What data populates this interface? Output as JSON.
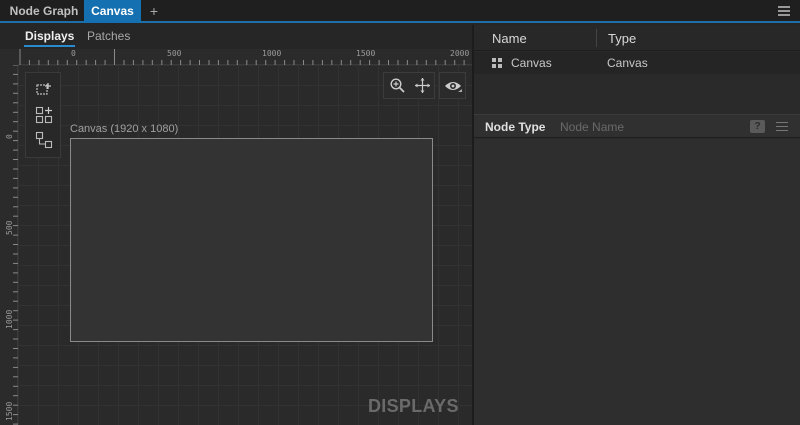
{
  "tabs": [
    {
      "label": "Node Graph",
      "active": false
    },
    {
      "label": "Canvas",
      "active": true
    }
  ],
  "add_tab_label": "+",
  "left_panel": {
    "subtabs": [
      {
        "label": "Displays",
        "active": true
      },
      {
        "label": "Patches",
        "active": false
      }
    ],
    "ruler_top_labels": [
      "0",
      "500",
      "1000",
      "1500",
      "2000"
    ],
    "ruler_left_labels": [
      "0",
      "500",
      "1000",
      "1500"
    ],
    "tools": [
      "add-display-icon",
      "add-group-icon",
      "link-display-icon"
    ],
    "view_controls": [
      "zoom-icon",
      "pan-icon",
      "visibility-icon"
    ],
    "canvas_label": "Canvas (1920 x 1080)",
    "watermark": "DISPLAYS"
  },
  "right_panel": {
    "columns": {
      "name": "Name",
      "type": "Type"
    },
    "rows": [
      {
        "name": "Canvas",
        "type": "Canvas",
        "icon": "grid-icon"
      }
    ],
    "node_type_label": "Node Type",
    "node_name_placeholder": "Node Name",
    "help_label": "?"
  },
  "colors": {
    "accent": "#1470b0",
    "background": "#262626",
    "canvas_fill": "#333333"
  }
}
